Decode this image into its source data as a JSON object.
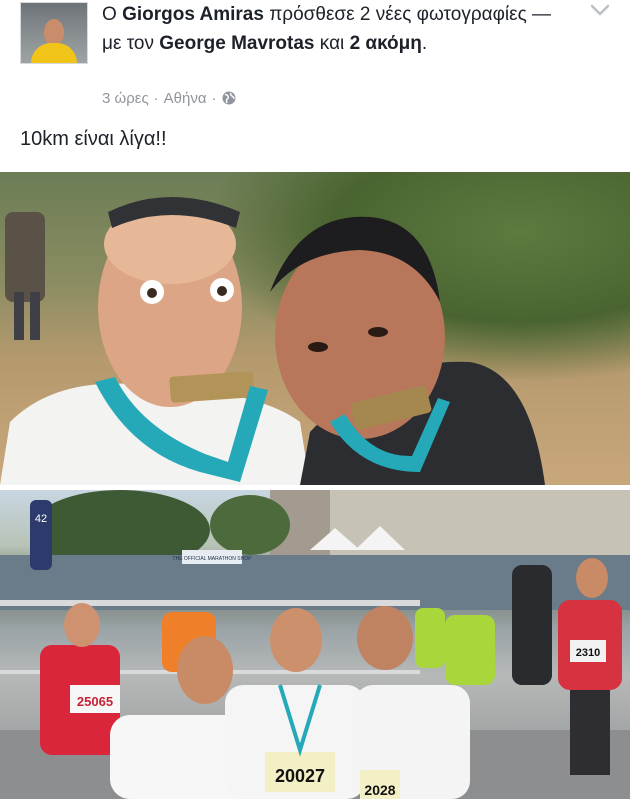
{
  "post": {
    "author": "Giorgos Amiras",
    "prefix": "Ο",
    "action": "πρόσθεσε 2 νέες φωτογραφίες — με τον",
    "tagged": "George Mavrotas",
    "and": "και",
    "others": "2 ακόμη",
    "period": ".",
    "time": "3 ώρες",
    "separator": "·",
    "location": "Αθήνα",
    "text": "10km είναι λίγα!!"
  },
  "photos": {
    "bib_1": "25065",
    "bib_2": "20027",
    "bib_3": "2310",
    "bib_4": "2028",
    "marker_42": "42",
    "sign_text": "THE OFFICIAL MARATHON SHOP"
  },
  "icons": {
    "menu": "chevron-down-icon",
    "privacy": "globe-icon"
  },
  "colors": {
    "text": "#1d2129",
    "meta": "#90949c",
    "lanyard": "#25a8b7"
  }
}
